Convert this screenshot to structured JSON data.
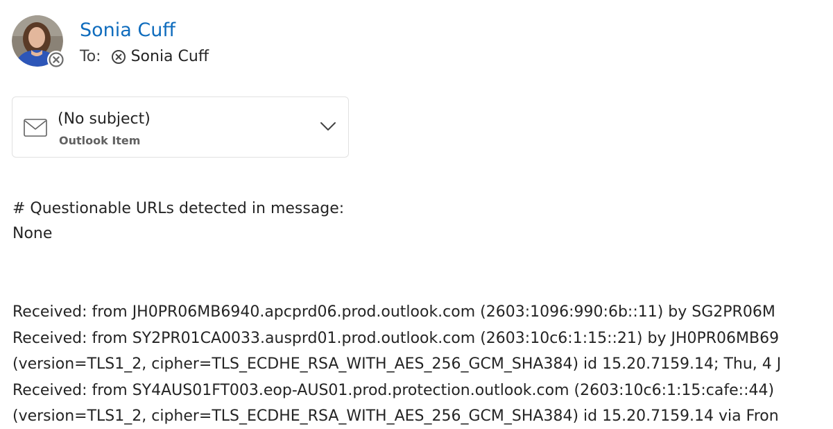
{
  "message": {
    "sender_name": "Sonia Cuff",
    "to_label": "To:",
    "recipients": [
      "Sonia Cuff"
    ]
  },
  "attachment": {
    "title": "(No subject)",
    "type": "Outlook Item",
    "icon": "mail-envelope-icon"
  },
  "body": {
    "questionable_urls_heading": "# Questionable URLs detected in message:",
    "questionable_urls_value": "None",
    "header_lines": [
      "Received: from JH0PR06MB6940.apcprd06.prod.outlook.com (2603:1096:990:6b::11) by SG2PR06M",
      "Received: from SY2PR01CA0033.ausprd01.prod.outlook.com (2603:10c6:1:15::21) by JH0PR06MB69",
      "(version=TLS1_2, cipher=TLS_ECDHE_RSA_WITH_AES_256_GCM_SHA384) id 15.20.7159.14; Thu, 4 J",
      "Received: from SY4AUS01FT003.eop-AUS01.prod.protection.outlook.com (2603:10c6:1:15:cafe::44)",
      "(version=TLS1_2, cipher=TLS_ECDHE_RSA_WITH_AES_256_GCM_SHA384) id 15.20.7159.14 via Fron"
    ]
  },
  "colors": {
    "sender_link": "#0f6cbd",
    "text": "#242424",
    "muted": "#616161",
    "card_border": "#e1e1e1"
  }
}
